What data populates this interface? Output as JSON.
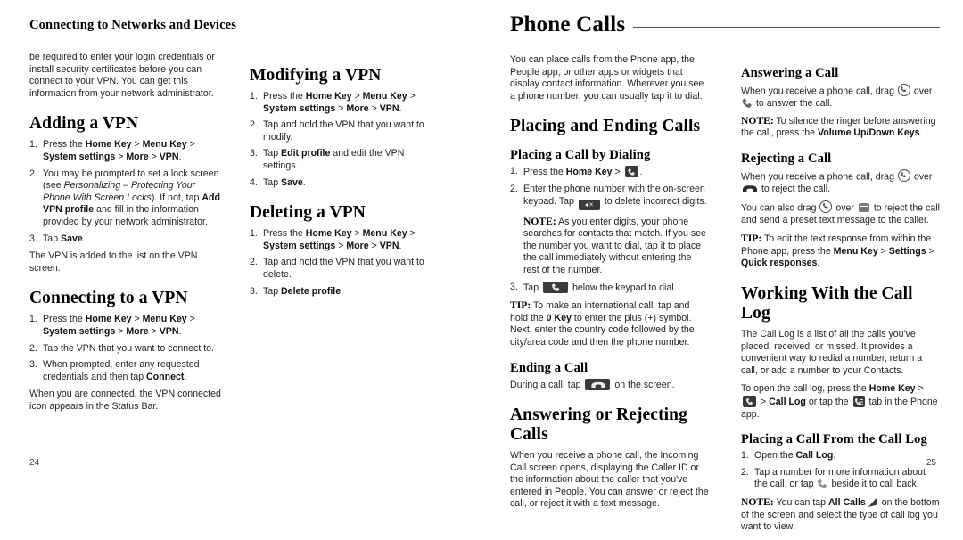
{
  "spread": {
    "left_page": {
      "running_head": "Connecting to Networks and Devices",
      "folio": "24",
      "col1": {
        "intro": "be required to enter your login credentials or install security certificates before you can connect to your VPN. You can get this information from your network administrator.",
        "adding_heading": "Adding a VPN",
        "adding_step1_a": "Press the ",
        "adding_step1_home": "Home Key",
        "adding_step1_gt1": " > ",
        "adding_step1_menu": "Menu Key",
        "adding_step1_gt2": " > ",
        "adding_step1_sys": "System settings",
        "adding_step1_gt3": " > ",
        "adding_step1_more": "More",
        "adding_step1_gt4": " > ",
        "adding_step1_vpn": "VPN",
        "adding_step1_end": ".",
        "adding_step2_a": "You may be prompted to set a lock screen (see ",
        "adding_step2_italic": "Personalizing – Protecting Your Phone With Screen Locks",
        "adding_step2_b": "). If not, tap ",
        "adding_step2_bold": "Add VPN profile",
        "adding_step2_c": " and fill in the information provided by your network administrator.",
        "adding_step3_a": "Tap ",
        "adding_step3_bold": "Save",
        "adding_step3_b": ".",
        "adding_after": "The VPN is added to the list on the VPN screen.",
        "connecting_heading": "Connecting to a VPN",
        "connecting_step2": "Tap the VPN that you want to connect to.",
        "connecting_step3_a": "When prompted, enter any requested credentials and then tap ",
        "connecting_step3_bold": "Connect",
        "connecting_step3_b": ".",
        "connecting_after": "When you are connected, the VPN connected icon appears in the Status Bar."
      },
      "col2": {
        "modifying_heading": "Modifying a VPN",
        "modifying_step2": "Tap and hold the VPN that you want to modify.",
        "modifying_step3_a": "Tap ",
        "modifying_step3_bold": "Edit profile",
        "modifying_step3_b": " and edit the VPN settings.",
        "modifying_step4_a": "Tap ",
        "modifying_step4_bold": "Save",
        "modifying_step4_b": ".",
        "deleting_heading": "Deleting a VPN",
        "deleting_step2": "Tap and hold the VPN that you want to delete.",
        "deleting_step3_a": "Tap ",
        "deleting_step3_bold": "Delete profile",
        "deleting_step3_b": "."
      }
    },
    "right_page": {
      "chapter_title": "Phone Calls",
      "folio": "25",
      "col1": {
        "intro": "You can place calls from the Phone app, the People app, or other apps or widgets that display contact information. Wherever you see a phone number, you can usually tap it to dial.",
        "placing_heading": "Placing and Ending Calls",
        "dialing_heading": "Placing a Call by Dialing",
        "dialing_step1_a": "Press the ",
        "dialing_step1_bold": "Home Key",
        "dialing_step1_gt": " > ",
        "dialing_step1_end": ".",
        "dialing_step2_a": "Enter the phone number with the on-screen keypad. Tap ",
        "dialing_step2_b": " to delete incorrect digits.",
        "dialing_note_label": "NOTE:",
        "dialing_note_text": " As you enter digits, your phone searches for contacts that match. If you see the number you want to dial, tap it to place the call immediately without entering the rest of the number.",
        "dialing_step3_a": "Tap ",
        "dialing_step3_b": " below the keypad to dial.",
        "tip_label": "TIP:",
        "tip_a": " To make an international call, tap and hold the ",
        "tip_bold": "0 Key",
        "tip_b": " to enter the plus (+) symbol. Next, enter the country code followed by the city/area code and then the phone number.",
        "ending_heading": "Ending a Call",
        "ending_a": "During a call, tap ",
        "ending_b": " on the screen.",
        "answering_heading": "Answering or Rejecting Calls",
        "answering_intro": "When you receive a phone call, the Incoming Call screen opens, displaying the Caller ID or the information about the caller that you've entered in People. You can answer or reject the call, or reject it with a text message."
      },
      "col2": {
        "answering_heading": "Answering a Call",
        "answering_a": "When you receive a phone call, drag ",
        "answering_b": " over ",
        "answering_c": " to answer the call.",
        "answering_note_label": "NOTE:",
        "answering_note_a": " To silence the ringer before answering the call, press the ",
        "answering_note_bold": "Volume Up/Down Keys",
        "answering_note_b": ".",
        "rejecting_heading": "Rejecting a Call",
        "rejecting_a": "When you receive a phone call, drag ",
        "rejecting_b": " over ",
        "rejecting_c": " to reject the call.",
        "rejecting2_a": "You can also drag ",
        "rejecting2_b": " over ",
        "rejecting2_c": " to reject the call and send a preset text message to the caller.",
        "rejecting_tip_label": "TIP:",
        "rejecting_tip_a": " To edit the text response from within the Phone app, press the ",
        "rejecting_tip_menu": "Menu Key",
        "rejecting_tip_gt1": " > ",
        "rejecting_tip_settings": "Settings",
        "rejecting_tip_gt2": " > ",
        "rejecting_tip_quick": "Quick responses",
        "rejecting_tip_b": ".",
        "calllog_heading": "Working With the Call Log",
        "calllog_intro": "The Call Log is a list of all the calls you've placed, received, or missed. It provides a convenient way to redial a number, return a call, or add a number to your Contacts.",
        "calllog_open_a": "To open the call log, press the ",
        "calllog_open_home": "Home Key",
        "calllog_open_gt1": " > ",
        "calllog_open_gt2": " > ",
        "calllog_open_bold": "Call Log",
        "calllog_open_b": " or tap the ",
        "calllog_open_c": " tab in the Phone app.",
        "placing_from_heading": "Placing a Call From the Call Log",
        "placing_from_step1_a": "Open the ",
        "placing_from_step1_bold": "Call Log",
        "placing_from_step1_b": ".",
        "placing_from_step2_a": "Tap a number for more information about the call, or tap ",
        "placing_from_step2_b": " beside it to call back.",
        "placing_from_note_label": "NOTE:",
        "placing_from_note_a": " You can tap ",
        "placing_from_note_bold": "All Calls",
        "placing_from_note_b": " on the bottom of the screen and select the type of call log you want to view."
      }
    }
  },
  "icons": {
    "drag_handle": "circle-phone-icon",
    "answer": "handset-icon",
    "reject": "hangup-icon",
    "message": "speech-bubble-icon",
    "phone_tile": "phone-app-icon",
    "backspace_tile": "backspace-key-icon",
    "end_call_tile": "end-call-button-icon",
    "call_log_tab": "call-log-tab-icon",
    "all_calls": "all-calls-filter-icon"
  },
  "colors": {
    "page_bg": "#ffffff",
    "body_text": "#231f20",
    "heading_text": "#000000",
    "rule": "#4a4a4a",
    "icon_dark": "#3a3a3a",
    "icon_grey": "#6a6a6a"
  }
}
